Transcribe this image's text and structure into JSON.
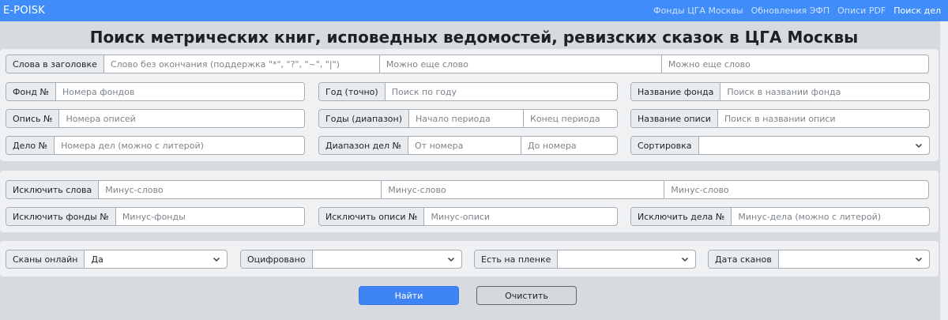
{
  "nav": {
    "brand": "E-POISK",
    "links": [
      "Фонды ЦГА Москвы",
      "Обновления ЭФП",
      "Описи PDF",
      "Поиск дел"
    ]
  },
  "title": "Поиск метрических книг, исповедных ведомостей, ревизских сказок в ЦГА Москвы",
  "search": {
    "words_label": "Слова в заголовке",
    "words_ph1": "Слово без окончания (поддержка \"*\", \"?\", \"~\", \"|\")",
    "words_ph2": "Можно еще слово",
    "words_ph3": "Можно еще слово",
    "fond_label": "Фонд №",
    "fond_ph": "Номера фондов",
    "year_label": "Год (точно)",
    "year_ph": "Поиск по году",
    "fond_name_label": "Название фонда",
    "fond_name_ph": "Поиск в названии фонда",
    "opis_label": "Опись №",
    "opis_ph": "Номера описей",
    "years_label": "Годы (диапазон)",
    "years_from_ph": "Начало периода",
    "years_to_ph": "Конец периода",
    "opis_name_label": "Название описи",
    "opis_name_ph": "Поиск в названии описи",
    "delo_label": "Дело №",
    "delo_ph": "Номера дел (можно с литерой)",
    "delo_range_label": "Диапазон дел №",
    "delo_from_ph": "От номера",
    "delo_to_ph": "До номера",
    "sort_label": "Сортировка",
    "sort_value": ""
  },
  "exclude": {
    "words_label": "Исключить слова",
    "words_ph1": "Минус-слово",
    "words_ph2": "Минус-слово",
    "words_ph3": "Минус-слово",
    "fonds_label": "Исключить фонды №",
    "fonds_ph": "Минус-фонды",
    "opisi_label": "Исключить описи №",
    "opisi_ph": "Минус-описи",
    "dela_label": "Исключить дела №",
    "dela_ph": "Минус-дела (можно с литерой)"
  },
  "filters": {
    "scans_online_label": "Сканы онлайн",
    "scans_online_value": "Да",
    "digitized_label": "Оцифровано",
    "digitized_value": "",
    "film_label": "Есть на пленке",
    "film_value": "",
    "scan_date_label": "Дата сканов",
    "scan_date_value": ""
  },
  "buttons": {
    "find": "Найти",
    "clear": "Очистить"
  }
}
